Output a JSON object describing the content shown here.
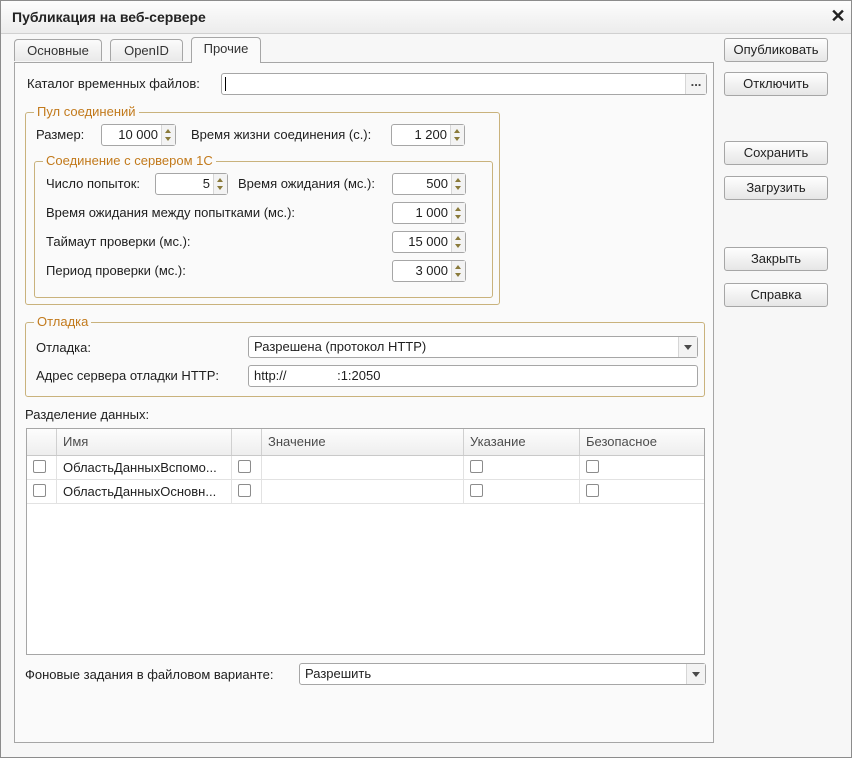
{
  "window": {
    "title": "Публикация на веб-сервере"
  },
  "tabs": [
    {
      "label": "Основные"
    },
    {
      "label": "OpenID"
    },
    {
      "label": "Прочие"
    }
  ],
  "temp_dir": {
    "label": "Каталог временных файлов:",
    "value": "",
    "button": "..."
  },
  "pool": {
    "title": "Пул соединений",
    "size_label": "Размер:",
    "size_value": "10 000",
    "lifetime_label": "Время жизни соединения (с.):",
    "lifetime_value": "1 200",
    "connection": {
      "title": "Соединение с сервером 1С",
      "attempts_label": "Число попыток:",
      "attempts_value": "5",
      "timeout_label": "Время ожидания (мс.):",
      "timeout_value": "500",
      "between_label": "Время ожидания между попытками (мс.):",
      "between_value": "1 000",
      "check_timeout_label": "Таймаут проверки (мс.):",
      "check_timeout_value": "15 000",
      "check_period_label": "Период проверки (мс.):",
      "check_period_value": "3 000"
    }
  },
  "debug": {
    "title": "Отладка",
    "mode_label": "Отладка:",
    "mode_value": "Разрешена (протокол HTTP)",
    "address_label": "Адрес сервера отладки HTTP:",
    "address_value": "http://              :1:2050"
  },
  "data_separation": {
    "label": "Разделение данных:",
    "columns": [
      "Имя",
      "Значение",
      "Указание",
      "Безопасное"
    ],
    "rows": [
      {
        "name": "ОбластьДанныхВспомо..."
      },
      {
        "name": "ОбластьДанныхОсновн..."
      }
    ]
  },
  "background_jobs": {
    "label": "Фоновые задания в файловом варианте:",
    "value": "Разрешить"
  },
  "buttons": {
    "publish": "Опубликовать",
    "disable": "Отключить",
    "save": "Сохранить",
    "load": "Загрузить",
    "close": "Закрыть",
    "help": "Справка"
  },
  "colors": {
    "group_border": "#c9b27c",
    "group_title": "#c27a1c",
    "window_bg": "#f7f7f7"
  }
}
